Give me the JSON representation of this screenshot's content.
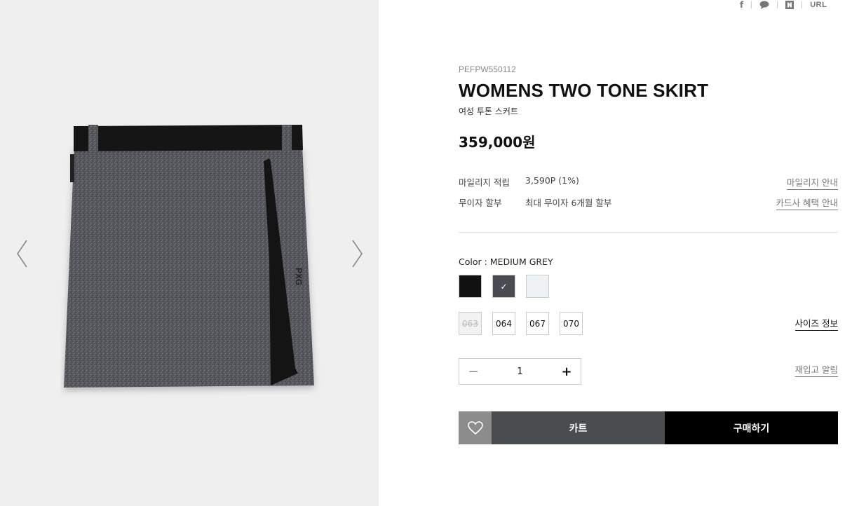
{
  "share": {
    "facebook": "f",
    "url_label": "URL",
    "icons": [
      "facebook-icon",
      "speech-bubble-icon",
      "naver-icon"
    ]
  },
  "product": {
    "code": "PEFPW550112",
    "title": "WOMENS TWO TONE SKIRT",
    "subtitle": "여성 투톤 스커트",
    "price": "359,000원"
  },
  "benefits": {
    "mileage_label": "마일리지 적립",
    "mileage_value": "3,590P (1%)",
    "mileage_link": "마일리지 안내",
    "installment_label": "무이자 할부",
    "installment_value": "최대 무이자 6개월 할부",
    "installment_link": "카드사 혜택 안내"
  },
  "options": {
    "color_label": "Color : MEDIUM GREY",
    "colors": [
      {
        "name": "BLACK",
        "hex": "#111111",
        "selected": false
      },
      {
        "name": "MEDIUM GREY",
        "hex": "#4a4a52",
        "selected": true
      },
      {
        "name": "WHITE",
        "hex": "#eef2f5",
        "selected": false
      }
    ],
    "check_mark": "✓",
    "sizes": [
      {
        "label": "063",
        "available": false
      },
      {
        "label": "064",
        "available": true
      },
      {
        "label": "067",
        "available": true
      },
      {
        "label": "070",
        "available": true
      }
    ],
    "size_info_link": "사이즈 정보"
  },
  "quantity": {
    "minus": "−",
    "value": "1",
    "plus": "+",
    "restock_link": "재입고 알림"
  },
  "actions": {
    "cart_label": "카트",
    "buy_label": "구매하기"
  },
  "gallery": {
    "image_logo_text": "PXG"
  }
}
